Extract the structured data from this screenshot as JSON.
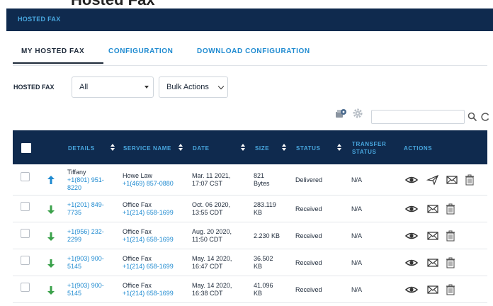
{
  "colors": {
    "navy": "#0f2a4e",
    "link": "#1e8ad0",
    "incoming": "#3aa14a",
    "outgoing": "#1e8ad0"
  },
  "header_partial": "Hosted Fax",
  "topbar": {
    "title": "HOSTED FAX"
  },
  "tabs": [
    {
      "label": "MY HOSTED FAX",
      "active": true
    },
    {
      "label": "CONFIGURATION",
      "active": false
    },
    {
      "label": "DOWNLOAD CONFIGURATION",
      "active": false
    }
  ],
  "filters": {
    "label": "HOSTED FAX",
    "hosted_fax_select": "All",
    "bulk_actions_select": "Bulk Actions"
  },
  "toolbar": {
    "icons": [
      "fax-settings-icon",
      "gear-icon"
    ],
    "search_placeholder": ""
  },
  "table": {
    "columns": [
      "DETAILS",
      "SERVICE NAME",
      "DATE",
      "SIZE",
      "STATUS",
      "TRANSFER STATUS",
      "ACTIONS"
    ],
    "transfer_status_lines": [
      "TRANSFER",
      "STATUS"
    ],
    "rows": [
      {
        "direction": "outgoing",
        "detail_name": "Tiffany",
        "detail_number_1": "+1(801) 951-",
        "detail_number_2": "8220",
        "service_name": "Howe Law",
        "service_number": "+1(469) 857-0880",
        "date_1": "Mar. 11 2021,",
        "date_2": "17:07 CST",
        "size_1": "821",
        "size_2": "Bytes",
        "status": "Delivered",
        "transfer_status": "N/A",
        "actions": [
          "eye-icon",
          "send-icon",
          "mail-icon",
          "trash-icon"
        ]
      },
      {
        "direction": "incoming",
        "detail_name": "",
        "detail_number_1": "+1(201) 849-",
        "detail_number_2": "7735",
        "service_name": "Office Fax",
        "service_number": "+1(214) 658-1699",
        "date_1": "Oct. 06 2020,",
        "date_2": "13:55 CDT",
        "size_1": "283.119",
        "size_2": "KB",
        "status": "Received",
        "transfer_status": "N/A",
        "actions": [
          "eye-icon",
          "mail-icon",
          "trash-icon"
        ]
      },
      {
        "direction": "incoming",
        "detail_name": "",
        "detail_number_1": "+1(956) 232-",
        "detail_number_2": "2299",
        "service_name": "Office Fax",
        "service_number": "+1(214) 658-1699",
        "date_1": "Aug. 20 2020,",
        "date_2": "11:50 CDT",
        "size_1": "2.230 KB",
        "size_2": "",
        "status": "Received",
        "transfer_status": "N/A",
        "actions": [
          "eye-icon",
          "mail-icon",
          "trash-icon"
        ]
      },
      {
        "direction": "incoming",
        "detail_name": "",
        "detail_number_1": "+1(903) 900-",
        "detail_number_2": "5145",
        "service_name": "Office Fax",
        "service_number": "+1(214) 658-1699",
        "date_1": "May. 14 2020,",
        "date_2": "16:47 CDT",
        "size_1": "36.502",
        "size_2": "KB",
        "status": "Received",
        "transfer_status": "N/A",
        "actions": [
          "eye-icon",
          "mail-icon",
          "trash-icon"
        ]
      },
      {
        "direction": "incoming",
        "detail_name": "",
        "detail_number_1": "+1(903) 900-",
        "detail_number_2": "5145",
        "service_name": "Office Fax",
        "service_number": "+1(214) 658-1699",
        "date_1": "May. 14 2020,",
        "date_2": "16:38 CDT",
        "size_1": "41.096",
        "size_2": "KB",
        "status": "Received",
        "transfer_status": "N/A",
        "actions": [
          "eye-icon",
          "mail-icon",
          "trash-icon"
        ]
      }
    ]
  }
}
